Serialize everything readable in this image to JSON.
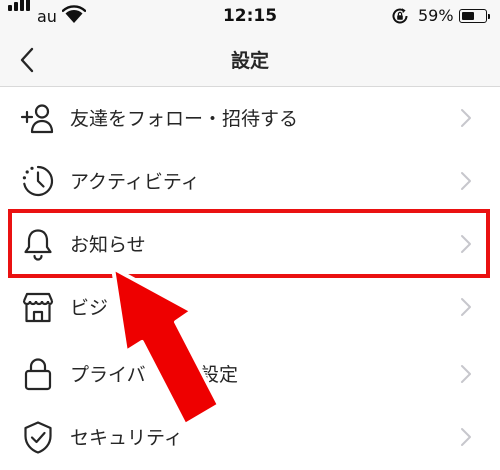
{
  "status_bar": {
    "carrier": "au",
    "time": "12:15",
    "battery_percent": "59%",
    "battery_level": 0.59,
    "icons": [
      "signal-bars-icon",
      "wifi-icon",
      "rotation-lock-icon",
      "battery-icon"
    ]
  },
  "nav": {
    "title": "設定",
    "back_icon": "chevron-left-icon"
  },
  "menu": {
    "items": [
      {
        "label": "友達をフォロー・招待する",
        "icon": "add-person-icon"
      },
      {
        "label": "アクティビティ",
        "icon": "activity-clock-icon"
      },
      {
        "label": "お知らせ",
        "icon": "bell-icon"
      },
      {
        "label": "ビジ",
        "icon": "storefront-icon"
      },
      {
        "label": "プライバ",
        "label_tail": "設定",
        "icon": "lock-icon"
      },
      {
        "label": "セキュリティ",
        "icon": "shield-check-icon"
      }
    ],
    "chevron_icon": "chevron-right-icon"
  },
  "annotations": {
    "highlight_color": "#ea1111",
    "arrow_color": "#ee0000",
    "highlighted_item": "お知らせ"
  }
}
